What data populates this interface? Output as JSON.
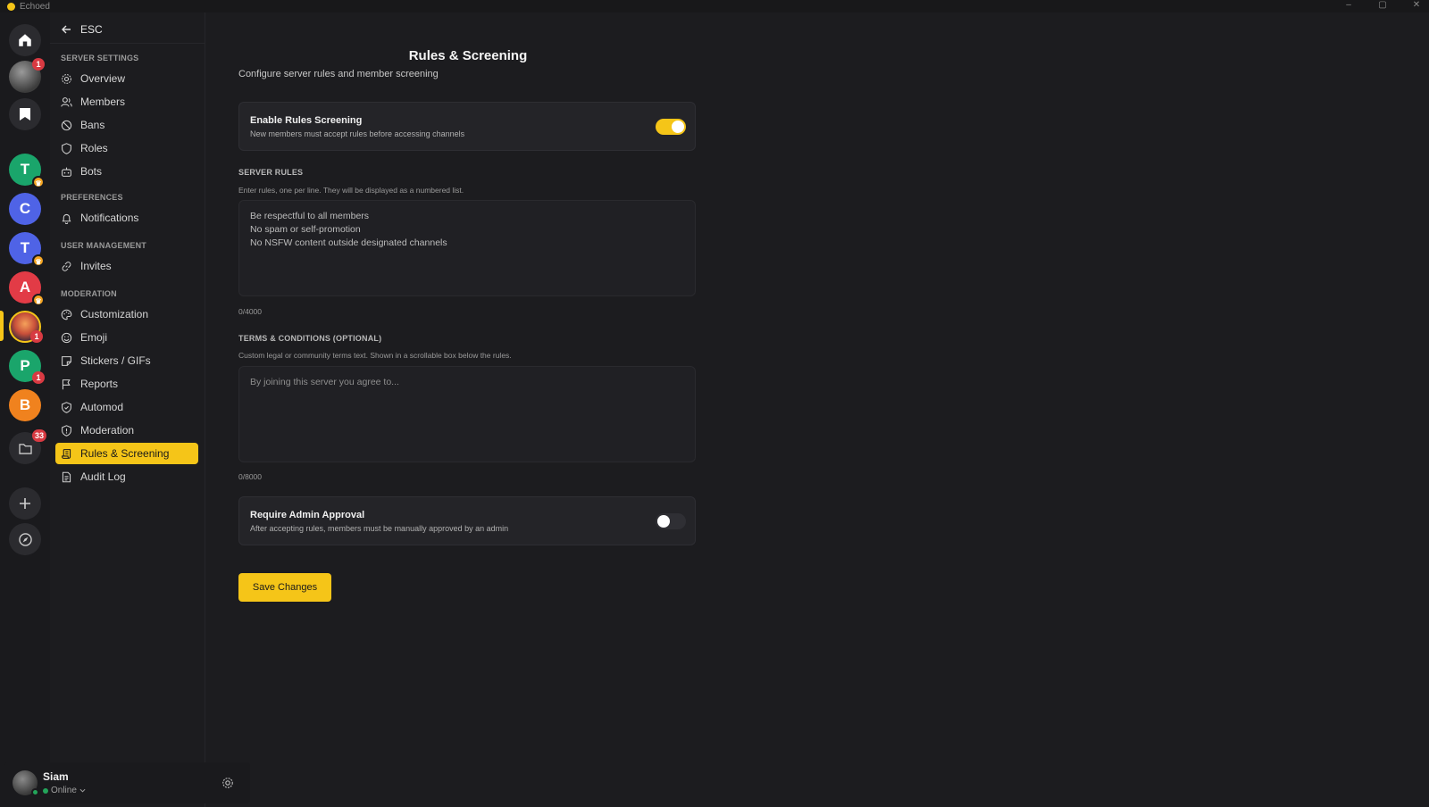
{
  "window": {
    "app_name": "Echoed",
    "controls": [
      "–",
      "▢",
      "✕"
    ]
  },
  "rail": {
    "servers": [
      {
        "name": "home-icon",
        "type": "icon"
      },
      {
        "name": "avatar-server",
        "type": "image",
        "badge": "1"
      },
      {
        "name": "bookmark-icon",
        "type": "icon"
      },
      {
        "letter": "T",
        "color": "#1aa56b",
        "crown": true
      },
      {
        "letter": "C",
        "color": "#4f63e6"
      },
      {
        "letter": "T",
        "color": "#4f63e6",
        "crown": true
      },
      {
        "letter": "A",
        "color": "#e23b46",
        "crown": true
      },
      {
        "name": "sunset-server",
        "type": "image",
        "badge": "1",
        "active": true
      },
      {
        "letter": "P",
        "color": "#1aa56b",
        "badge": "1"
      },
      {
        "letter": "B",
        "color": "#f0821e"
      },
      {
        "name": "folder-icon",
        "type": "icon",
        "badge": "33"
      },
      {
        "name": "add-server-icon",
        "type": "icon"
      },
      {
        "name": "explore-icon",
        "type": "icon"
      }
    ]
  },
  "sidebar": {
    "esc_label": "ESC",
    "sections": [
      {
        "label": "SERVER SETTINGS"
      },
      {
        "label": "PREFERENCES"
      },
      {
        "label": "USER MANAGEMENT"
      },
      {
        "label": "MODERATION"
      }
    ],
    "items": [
      {
        "label": "Overview",
        "icon": "gear-icon"
      },
      {
        "label": "Members",
        "icon": "members-icon"
      },
      {
        "label": "Bans",
        "icon": "ban-icon"
      },
      {
        "label": "Roles",
        "icon": "shield-icon"
      },
      {
        "label": "Bots",
        "icon": "bot-icon"
      },
      {
        "label": "Notifications",
        "icon": "bell-icon"
      },
      {
        "label": "Invites",
        "icon": "link-icon"
      },
      {
        "label": "Customization",
        "icon": "palette-icon"
      },
      {
        "label": "Emoji",
        "icon": "smile-icon"
      },
      {
        "label": "Stickers / GIFs",
        "icon": "sticker-icon"
      },
      {
        "label": "Reports",
        "icon": "flag-icon"
      },
      {
        "label": "Automod",
        "icon": "shield-check-icon"
      },
      {
        "label": "Moderation",
        "icon": "shield-alert-icon"
      },
      {
        "label": "Rules & Screening",
        "icon": "scroll-icon",
        "active": true
      },
      {
        "label": "Audit Log",
        "icon": "document-icon"
      }
    ]
  },
  "user": {
    "name": "Siam",
    "status": "Online"
  },
  "main": {
    "title": "Rules & Screening",
    "subtitle": "Configure server rules and member screening",
    "rules_screening": {
      "title": "Enable Rules Screening",
      "description": "New members must accept rules before accessing channels",
      "enabled": true
    },
    "server_rules": {
      "label": "SERVER RULES",
      "hint": "Enter rules, one per line. They will be displayed as a numbered list.",
      "lines": [
        "Be respectful to all members",
        "No spam or self-promotion",
        "No NSFW content outside designated channels"
      ],
      "counter": "0/4000"
    },
    "terms": {
      "label": "TERMS & CONDITIONS (OPTIONAL)",
      "hint": "Custom legal or community terms text. Shown in a scrollable box below the rules.",
      "placeholder": "By joining this server you agree to...",
      "counter": "0/8000"
    },
    "admin_approval": {
      "title": "Require Admin Approval",
      "description": "After accepting rules, members must be manually approved by an admin",
      "enabled": false
    },
    "save_label": "Save Changes"
  },
  "colors": {
    "accent": "#f5c518",
    "background": "#1c1c1f",
    "card": "#242428"
  }
}
